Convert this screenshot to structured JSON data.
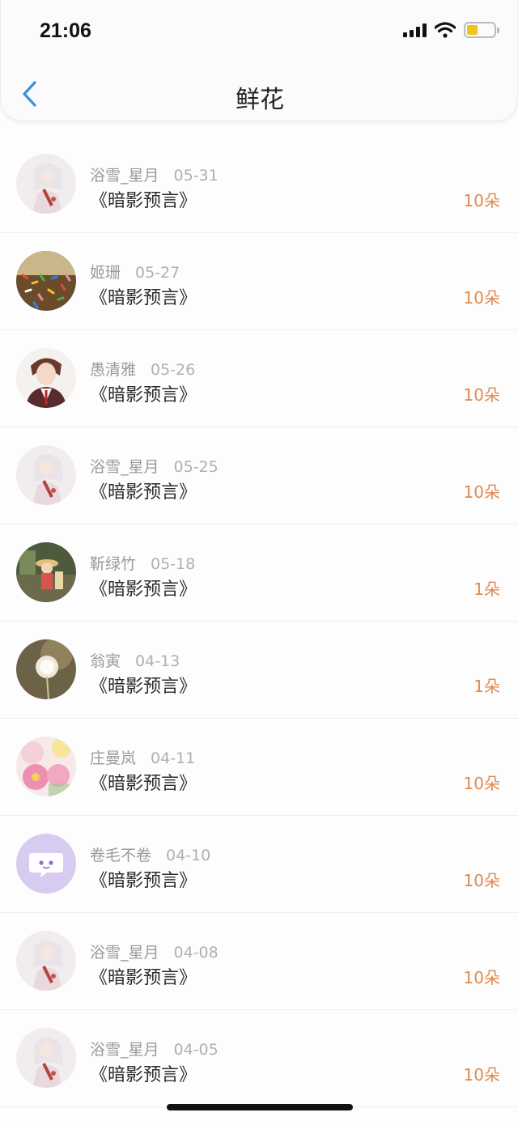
{
  "status_bar": {
    "time": "21:06"
  },
  "nav": {
    "title": "鲜花"
  },
  "colors": {
    "accent": "#e08a4e",
    "back": "#3b8fe0"
  },
  "items": [
    {
      "name": "浴雪_星月",
      "date": "05-31",
      "book": "《暗影预言》",
      "count": "10朵",
      "avatar": "anime-girl-white-hair"
    },
    {
      "name": "姬珊",
      "date": "05-27",
      "book": "《暗影预言》",
      "count": "10朵",
      "avatar": "sprinkles-dessert"
    },
    {
      "name": "愚清雅",
      "date": "05-26",
      "book": "《暗影预言》",
      "count": "10朵",
      "avatar": "anime-man-suit"
    },
    {
      "name": "浴雪_星月",
      "date": "05-25",
      "book": "《暗影预言》",
      "count": "10朵",
      "avatar": "anime-girl-white-hair"
    },
    {
      "name": "靳绿竹",
      "date": "05-18",
      "book": "《暗影预言》",
      "count": "1朵",
      "avatar": "anime-kid-straw-hat"
    },
    {
      "name": "翁寅",
      "date": "04-13",
      "book": "《暗影预言》",
      "count": "1朵",
      "avatar": "dandelion"
    },
    {
      "name": "庄曼岚",
      "date": "04-11",
      "book": "《暗影预言》",
      "count": "10朵",
      "avatar": "pink-flowers"
    },
    {
      "name": "卷毛不卷",
      "date": "04-10",
      "book": "《暗影预言》",
      "count": "10朵",
      "avatar": "default-purple-chat"
    },
    {
      "name": "浴雪_星月",
      "date": "04-08",
      "book": "《暗影预言》",
      "count": "10朵",
      "avatar": "anime-girl-white-hair"
    },
    {
      "name": "浴雪_星月",
      "date": "04-05",
      "book": "《暗影预言》",
      "count": "10朵",
      "avatar": "anime-girl-white-hair"
    }
  ]
}
